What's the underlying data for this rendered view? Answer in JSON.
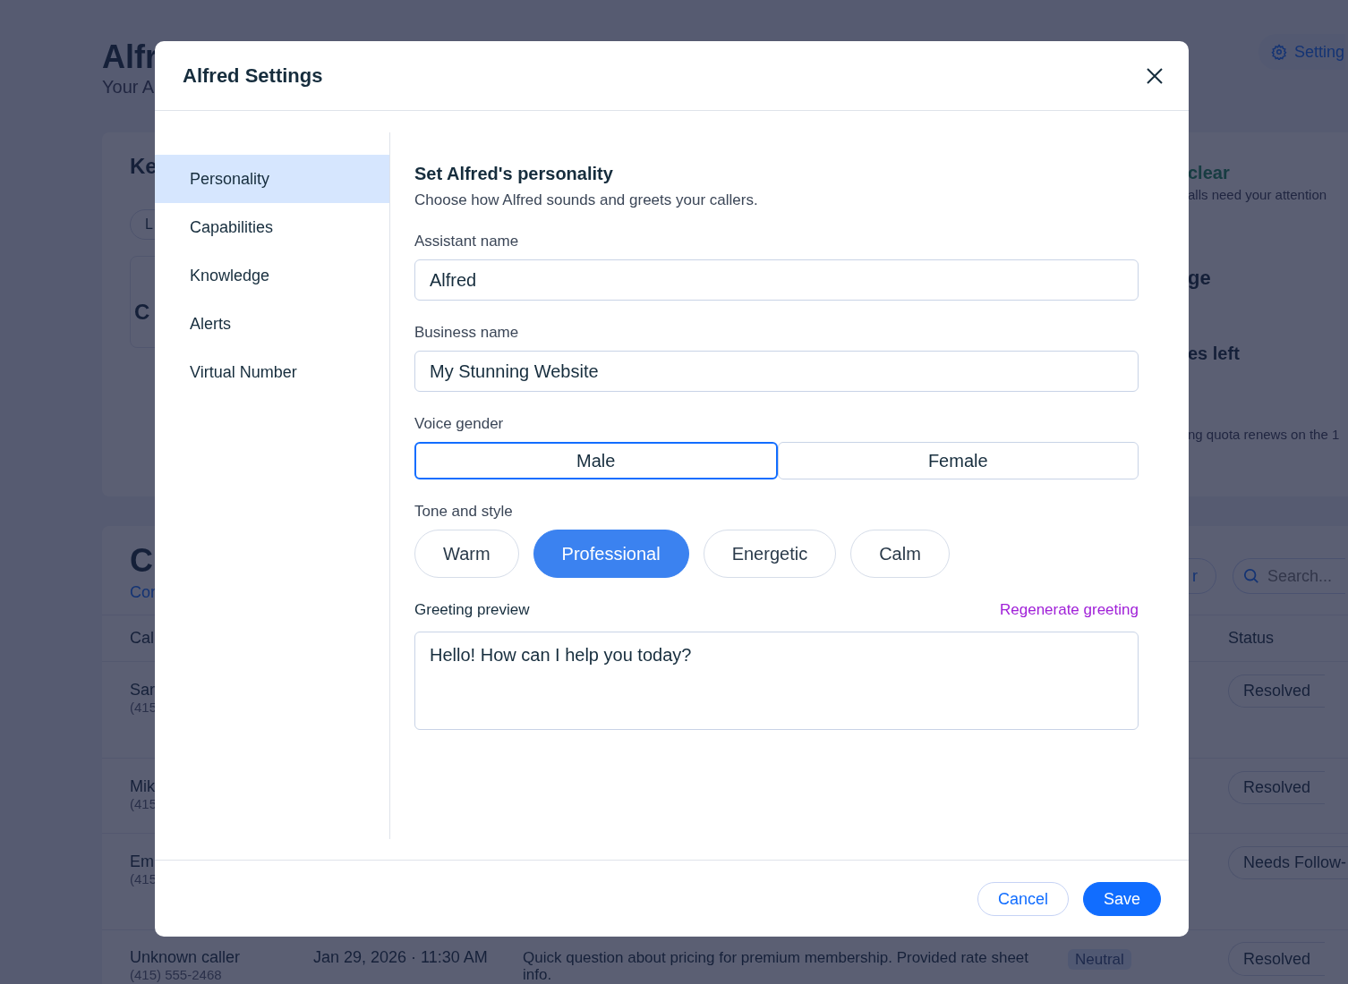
{
  "page": {
    "title": "Alfr",
    "subtitle": "Your A",
    "settings_button": "Setting"
  },
  "summary_card": {
    "title": "Ke",
    "filter_pill": "L",
    "stat_value": "C",
    "status_title": "clear",
    "status_text": "alls need your attention",
    "usage_title": "ge",
    "usage_value": "es left",
    "usage_note": "ng quota renews on the 1"
  },
  "calls_card": {
    "title": "C",
    "link": "Cor",
    "filter_button": "r",
    "search": {
      "placeholder": "Search..."
    },
    "columns": [
      "Cal",
      "Status"
    ],
    "rows": [
      {
        "caller": "Sar",
        "phone": "(415",
        "status": "Resolved"
      },
      {
        "caller": "Mik",
        "phone": "(415",
        "status": "Resolved"
      },
      {
        "caller": "Em",
        "phone": "(415",
        "status": "Needs Follow-"
      },
      {
        "caller": "Unknown caller",
        "phone": "(415) 555-2468",
        "date": "Jan 29, 2026 · 11:30 AM",
        "summary": "Quick question about pricing for premium membership. Provided rate sheet info.",
        "sentiment": "Neutral",
        "status": "Resolved"
      }
    ]
  },
  "modal": {
    "title": "Alfred Settings",
    "sidebar": [
      {
        "label": "Personality",
        "selected": true
      },
      {
        "label": "Capabilities",
        "selected": false
      },
      {
        "label": "Knowledge",
        "selected": false
      },
      {
        "label": "Alerts",
        "selected": false
      },
      {
        "label": "Virtual Number",
        "selected": false
      }
    ],
    "section_title": "Set Alfred's personality",
    "section_subtitle": "Choose how Alfred sounds and greets your callers.",
    "fields": [
      {
        "label": "Assistant name",
        "value": "Alfred"
      },
      {
        "label": "Business name",
        "value": "My Stunning Website"
      }
    ],
    "voice_gender": {
      "label": "Voice gender",
      "options": [
        {
          "label": "Male",
          "selected": true
        },
        {
          "label": "Female",
          "selected": false
        }
      ]
    },
    "tone": {
      "label": "Tone and style",
      "options": [
        {
          "label": "Warm",
          "selected": false
        },
        {
          "label": "Professional",
          "selected": true
        },
        {
          "label": "Energetic",
          "selected": false
        },
        {
          "label": "Calm",
          "selected": false
        }
      ]
    },
    "greeting": {
      "label": "Greeting preview",
      "action": "Regenerate greeting",
      "value": "Hello! How can I help you today?"
    },
    "buttons": [
      {
        "label": "Cancel",
        "kind": "secondary"
      },
      {
        "label": "Save",
        "kind": "primary"
      }
    ]
  }
}
